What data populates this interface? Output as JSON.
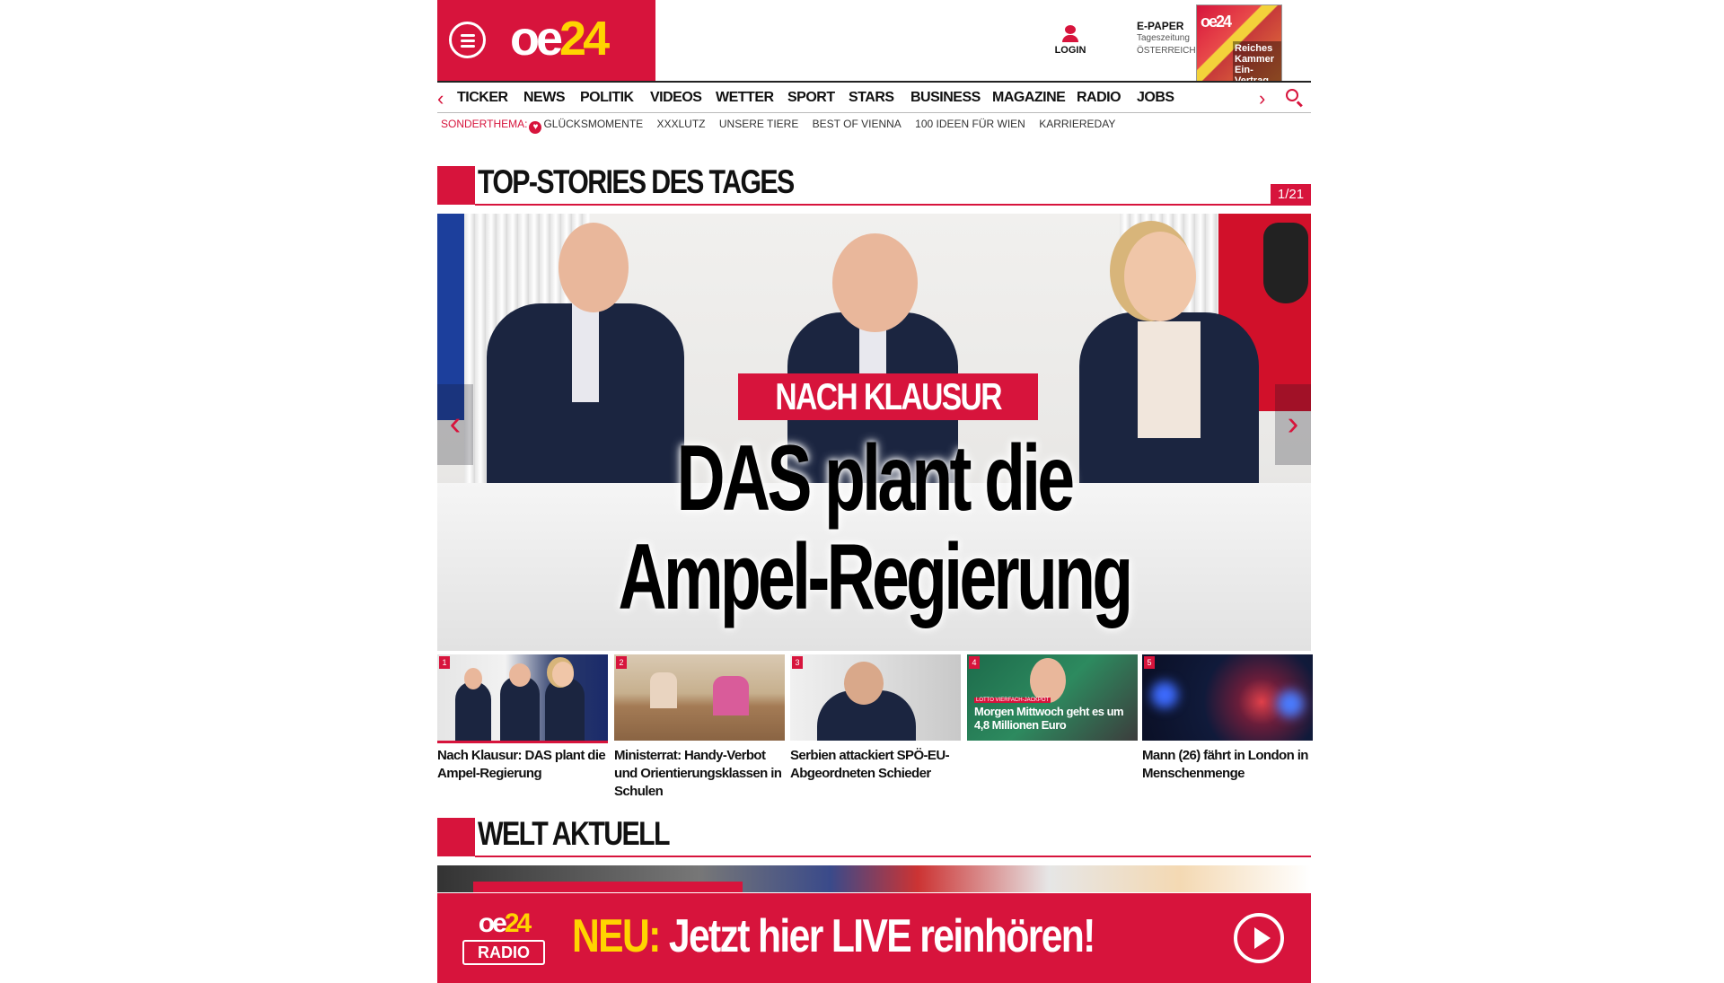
{
  "header": {
    "logo": "oe24",
    "login_label": "LOGIN",
    "epaper_title": "E-PAPER",
    "epaper_sub1": "Tageszeitung",
    "epaper_sub2": "ÖSTERREICH",
    "epaper_cover_logo": "oe24",
    "epaper_cover_headline": "Reiches Kammer Ein-Vertrag"
  },
  "nav": {
    "items": [
      "TICKER",
      "NEWS",
      "POLITIK",
      "VIDEOS",
      "WETTER",
      "SPORT",
      "STARS",
      "BUSINESS",
      "MAGAZINE",
      "RADIO",
      "JOBS"
    ],
    "prev_glyph": "‹",
    "next_glyph": "›"
  },
  "subnav": {
    "sonderthema": "SONDERTHEMA:",
    "items": [
      "GLÜCKSMOMENTE",
      "XXXLUTZ",
      "UNSERE TIERE",
      "BEST OF VIENNA",
      "100 IDEEN FÜR WIEN",
      "KARRIEREDAY"
    ]
  },
  "top_stories": {
    "title": "TOP-STORIES DES TAGES",
    "counter": "1/21",
    "hero_kicker": "NACH KLAUSUR",
    "hero_headline_line1": "DAS plant die",
    "hero_headline_line2": "Ampel-Regierung",
    "arrow_left": "‹",
    "arrow_right": "›",
    "thumbs": [
      {
        "num": "1",
        "text": "Nach Klausur: DAS plant die Ampel-Regierung"
      },
      {
        "num": "2",
        "text": "Ministerrat: Handy-Verbot und Orientierungsklassen in Schulen"
      },
      {
        "num": "3",
        "text": "Serbien attackiert SPÖ-EU-Abgeordneten Schieder"
      },
      {
        "num": "4",
        "text": "",
        "overlay_small": "LOTTO VIERFACH-JACKPOT",
        "overlay": "Morgen Mittwoch geht es um 4,8 Millionen Euro"
      },
      {
        "num": "5",
        "text": "Mann (26) fährt in London in Menschenmenge"
      }
    ]
  },
  "welt": {
    "title": "WELT AKTUELL"
  },
  "radio_banner": {
    "logo_top": "oe24",
    "logo_bottom": "RADIO",
    "neu": "NEU:",
    "text": " Jetzt hier LIVE reinhören!"
  },
  "colors": {
    "brand_red": "#d7143c",
    "brand_yellow": "#ffd400"
  }
}
